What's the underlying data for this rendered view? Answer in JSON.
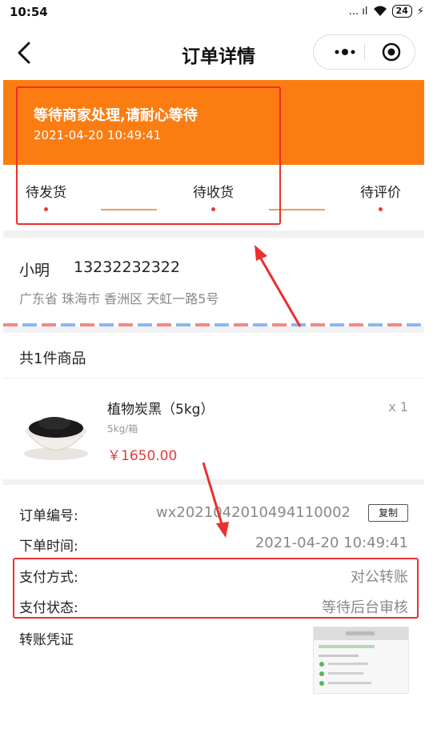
{
  "status_bar": {
    "time": "10:54",
    "signal": "... ıl",
    "battery": "24"
  },
  "nav": {
    "title": "订单详情"
  },
  "order_status": {
    "title": "等待商家处理,请耐心等待",
    "time": "2021-04-20    10:49:41"
  },
  "steps": [
    {
      "label": "待发货"
    },
    {
      "label": "待收货"
    },
    {
      "label": "待评价"
    }
  ],
  "address": {
    "name": "小明",
    "phone": "13232232322",
    "detail": "广东省 珠海市 香洲区 天虹一路5号"
  },
  "goods": {
    "count_text": "共1件商品",
    "items": [
      {
        "name": "植物炭黑（5kg）",
        "spec": "5kg/箱",
        "price": "￥1650.00",
        "qty": "x 1"
      }
    ]
  },
  "order_info": {
    "number_label": "订单编号:",
    "number_value": "wx202104201049411000​2",
    "copy_label": "复制",
    "time_label": "下单时间:",
    "time_value": "2021-04-20 10:49:41",
    "pay_method_label": "支付方式:",
    "pay_method_value": "对公转账",
    "pay_status_label": "支付状态:",
    "pay_status_value": "等待后台审核",
    "voucher_label": "转账凭证"
  },
  "colors": {
    "accent": "#fb7d12",
    "price": "#e43b3b",
    "highlight": "#e8302f"
  }
}
